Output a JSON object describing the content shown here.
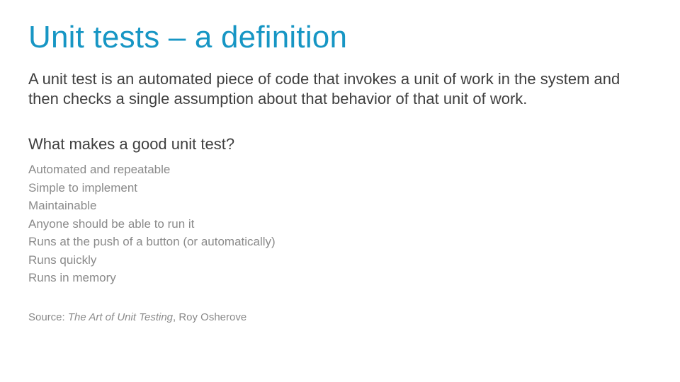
{
  "title": "Unit tests – a definition",
  "definition": "A unit test is an automated piece of code that invokes a unit of work in the system and then checks a single assumption about that behavior of that unit of work.",
  "subhead": "What makes a good unit test?",
  "bullets": [
    "Automated and repeatable",
    "Simple to implement",
    "Maintainable",
    "Anyone should be able to run it",
    "Runs at the push of a button (or automatically)",
    "Runs quickly",
    "Runs in memory"
  ],
  "source": {
    "prefix": "Source: ",
    "book": "The Art of Unit Testing",
    "suffix": ", Roy Osherove"
  }
}
